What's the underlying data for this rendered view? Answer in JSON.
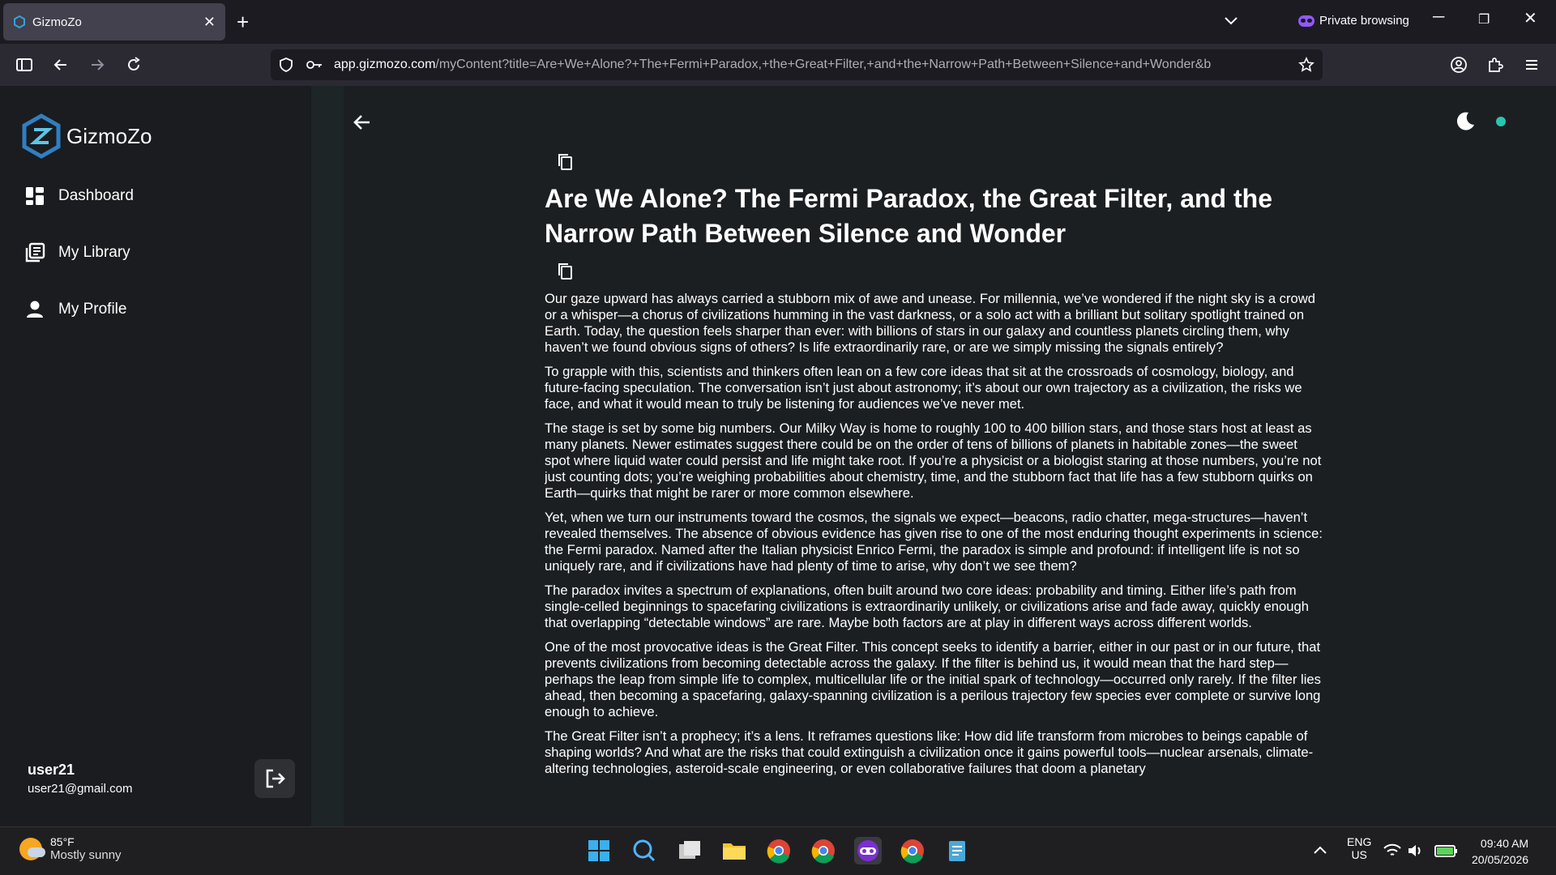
{
  "browser": {
    "tab_title": "GizmoZo",
    "private_label": "Private browsing",
    "url_host": "app.gizmozo.com",
    "url_path": "/myContent?title=Are+We+Alone?+The+Fermi+Paradox,+the+Great+Filter,+and+the+Narrow+Path+Between+Silence+and+Wonder&b"
  },
  "sidebar": {
    "brand": "GizmoZo",
    "items": [
      {
        "label": "Dashboard",
        "icon": "dashboard-icon"
      },
      {
        "label": "My Library",
        "icon": "library-icon"
      },
      {
        "label": "My Profile",
        "icon": "person-icon"
      }
    ],
    "user": {
      "name": "user21",
      "email": "user21@gmail.com"
    }
  },
  "article": {
    "title": "Are We Alone? The Fermi Paradox, the Great Filter, and the Narrow Path Between Silence and Wonder",
    "paragraphs": [
      "Our gaze upward has always carried a stubborn mix of awe and unease. For millennia, we’ve wondered if the night sky is a crowd or a whisper—a chorus of civilizations humming in the vast darkness, or a solo act with a brilliant but solitary spotlight trained on Earth. Today, the question feels sharper than ever: with billions of stars in our galaxy and countless planets circling them, why haven’t we found obvious signs of others? Is life extraordinarily rare, or are we simply missing the signals entirely?",
      "To grapple with this, scientists and thinkers often lean on a few core ideas that sit at the crossroads of cosmology, biology, and future-facing speculation. The conversation isn’t just about astronomy; it’s about our own trajectory as a civilization, the risks we face, and what it would mean to truly be listening for audiences we’ve never met.",
      "The stage is set by some big numbers. Our Milky Way is home to roughly 100 to 400 billion stars, and those stars host at least as many planets. Newer estimates suggest there could be on the order of tens of billions of planets in habitable zones—the sweet spot where liquid water could persist and life might take root. If you’re a physicist or a biologist staring at those numbers, you’re not just counting dots; you’re weighing probabilities about chemistry, time, and the stubborn fact that life has a few stubborn quirks on Earth—quirks that might be rarer or more common elsewhere.",
      "Yet, when we turn our instruments toward the cosmos, the signals we expect—beacons, radio chatter, mega-structures—haven’t revealed themselves. The absence of obvious evidence has given rise to one of the most enduring thought experiments in science: the Fermi paradox. Named after the Italian physicist Enrico Fermi, the paradox is simple and profound: if intelligent life is not so uniquely rare, and if civilizations have had plenty of time to arise, why don’t we see them?",
      "The paradox invites a spectrum of explanations, often built around two core ideas: probability and timing. Either life’s path from single-celled beginnings to spacefaring civilizations is extraordinarily unlikely, or civilizations arise and fade away, quickly enough that overlapping “detectable windows” are rare. Maybe both factors are at play in different ways across different worlds.",
      "One of the most provocative ideas is the Great Filter. This concept seeks to identify a barrier, either in our past or in our future, that prevents civilizations from becoming detectable across the galaxy. If the filter is behind us, it would mean that the hard step—perhaps the leap from simple life to complex, multicellular life or the initial spark of technology—occurred only rarely. If the filter lies ahead, then becoming a spacefaring, galaxy-spanning civilization is a perilous trajectory few species ever complete or survive long enough to achieve.",
      "The Great Filter isn’t a prophecy; it’s a lens. It reframes questions like: How did life transform from microbes to beings capable of shaping worlds? And what are the risks that could extinguish a civilization once it gains powerful tools—nuclear arsenals, climate-altering technologies, asteroid-scale engineering, or even collaborative failures that doom a planetary"
    ]
  },
  "taskbar": {
    "weather_temp": "85°F",
    "weather_cond": "Mostly sunny",
    "lang": "ENG",
    "region": "US",
    "time": "09:40 AM",
    "date": "20/05/2026"
  },
  "colors": {
    "accent": "#26c6b0",
    "private": "#9059ff"
  }
}
